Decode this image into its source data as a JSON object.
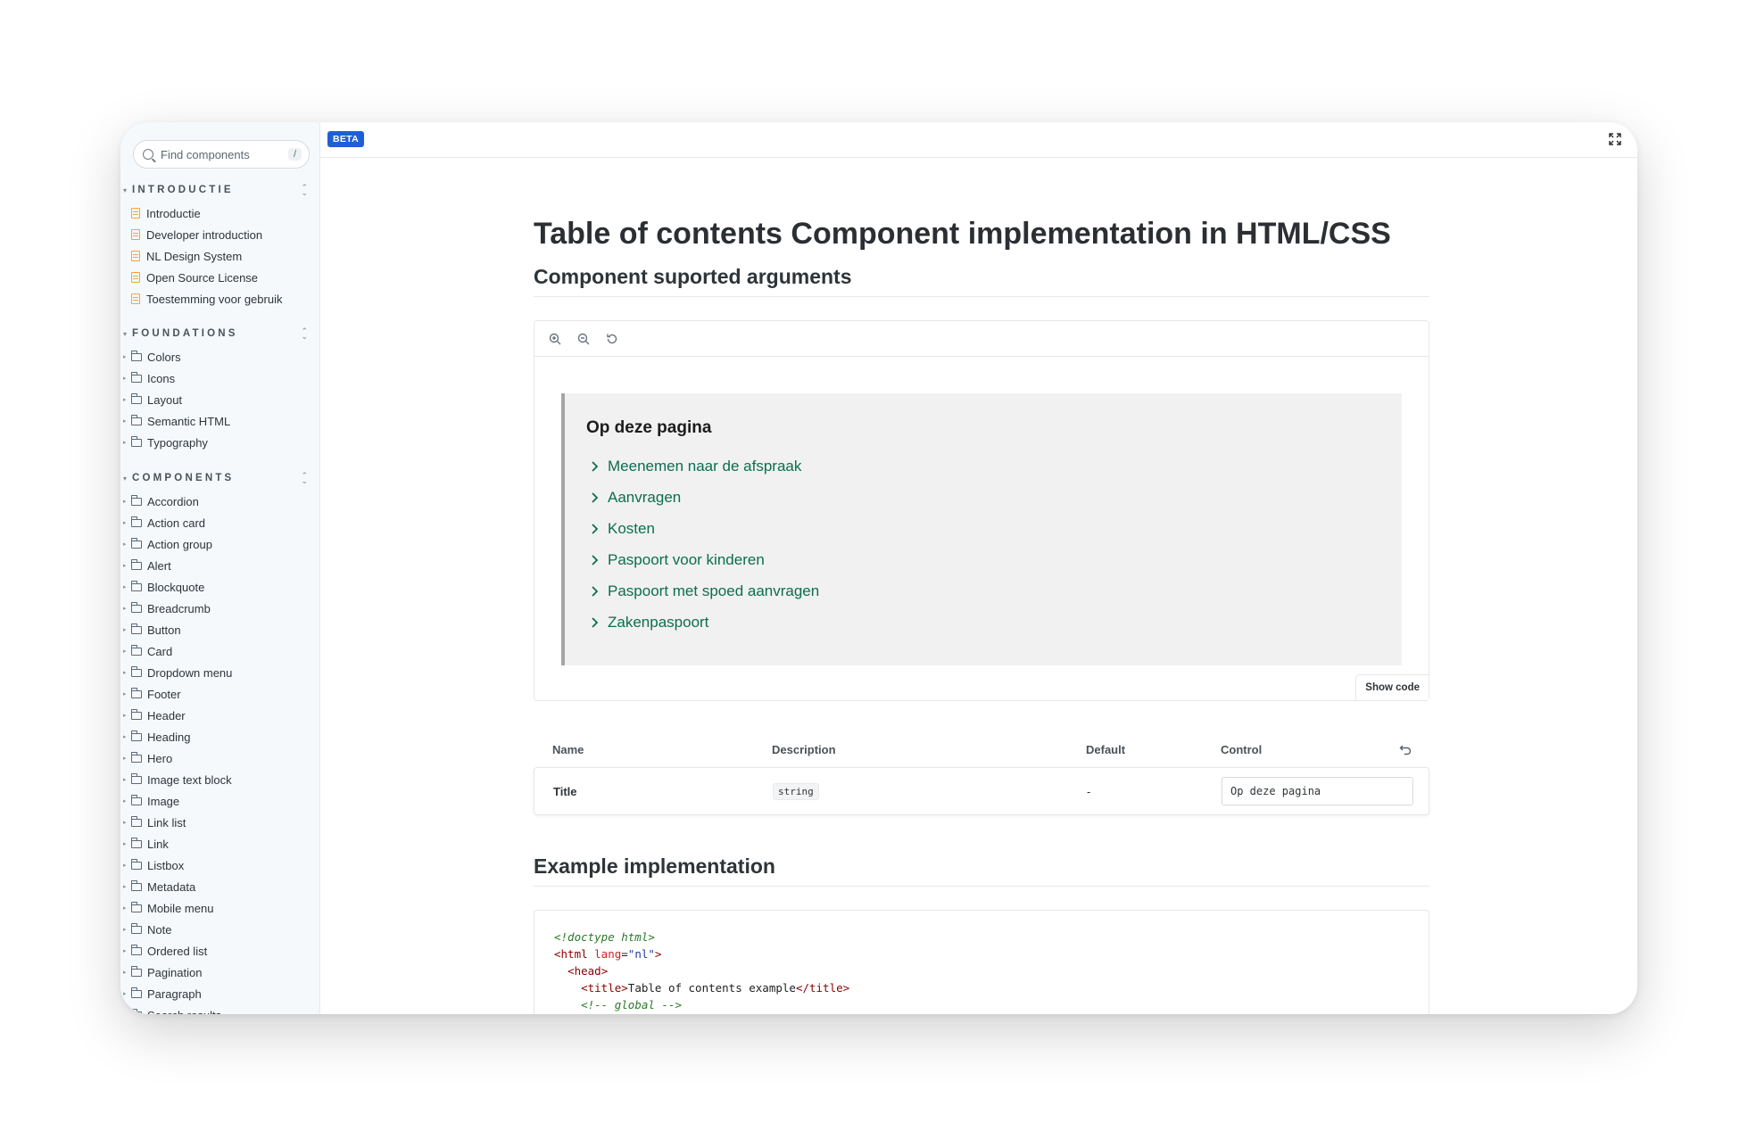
{
  "sidebar": {
    "search_placeholder": "Find components",
    "search_key": "/",
    "sections": [
      {
        "title": "INTRODUCTIE",
        "items": [
          "Introductie",
          "Developer introduction",
          "NL Design System",
          "Open Source License",
          "Toestemming voor gebruik"
        ]
      },
      {
        "title": "FOUNDATIONS",
        "items": [
          "Colors",
          "Icons",
          "Layout",
          "Semantic HTML",
          "Typography"
        ]
      },
      {
        "title": "COMPONENTS",
        "items": [
          "Accordion",
          "Action card",
          "Action group",
          "Alert",
          "Blockquote",
          "Breadcrumb",
          "Button",
          "Card",
          "Dropdown menu",
          "Footer",
          "Header",
          "Heading",
          "Hero",
          "Image text block",
          "Image",
          "Link list",
          "Link",
          "Listbox",
          "Metadata",
          "Mobile menu",
          "Note",
          "Ordered list",
          "Pagination",
          "Paragraph",
          "Search results"
        ]
      }
    ]
  },
  "topbar": {
    "beta_label": "BETA"
  },
  "main": {
    "title": "Table of contents Component implementation in HTML/CSS",
    "subtitle": "Component suported arguments",
    "preview": {
      "toc_title": "Op deze pagina",
      "toc_items": [
        "Meenemen naar de afspraak",
        "Aanvragen",
        "Kosten",
        "Paspoort voor kinderen",
        "Paspoort met spoed aanvragen",
        "Zakenpaspoort"
      ],
      "show_code": "Show code"
    },
    "args": {
      "headers": {
        "name": "Name",
        "description": "Description",
        "default": "Default",
        "control": "Control"
      },
      "row": {
        "name": "Title",
        "type": "string",
        "default": "-",
        "value": "Op deze pagina"
      }
    },
    "example_title": "Example implementation",
    "code_lines": {
      "l1": "<!doctype html>",
      "l2_tag_open": "<html ",
      "l2_attr": "lang",
      "l2_eq": "=",
      "l2_val": "\"nl\"",
      "l2_close": ">",
      "l3": "<head>",
      "l4_open": "<title>",
      "l4_text": "Table of contents example",
      "l4_close": "</title>",
      "l5": "<!-- global -->"
    }
  },
  "colors": {
    "accent": "#1f5fd6",
    "toc_link": "#0b6e4f",
    "doc_icon": "#f0a244"
  }
}
